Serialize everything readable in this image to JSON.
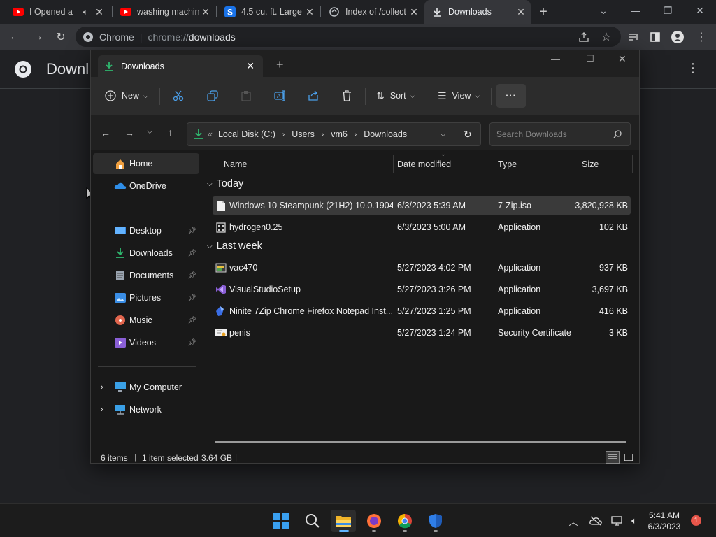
{
  "browser": {
    "tabs": [
      {
        "title": "I Opened a",
        "icon": "youtube-icon",
        "audio": true
      },
      {
        "title": "washing machin",
        "icon": "youtube-icon"
      },
      {
        "title": "4.5 cu. ft. Large",
        "icon": "s-site-icon"
      },
      {
        "title": "Index of /collect",
        "icon": "archive-icon"
      },
      {
        "title": "Downloads",
        "icon": "download-icon",
        "active": true
      }
    ],
    "new_tab": "+",
    "omnibox": {
      "prefix": "Chrome",
      "url_scheme": "chrome://",
      "url_host": "downloads"
    },
    "page_title": "Downl"
  },
  "explorer": {
    "tab_title": "Downloads",
    "new_tab": "+",
    "commands": {
      "new": "New",
      "sort": "Sort",
      "view": "View",
      "more": "···"
    },
    "breadcrumb": [
      "Local Disk (C:)",
      "Users",
      "vm6",
      "Downloads"
    ],
    "breadcrumb_overflow": "«",
    "search_placeholder": "Search Downloads",
    "nav": {
      "home": "Home",
      "onedrive": "OneDrive",
      "quick": [
        {
          "label": "Desktop",
          "icon": "desktop-icon",
          "color": "#3a8ee6"
        },
        {
          "label": "Downloads",
          "icon": "downloads-icon",
          "color": "#2fb86f"
        },
        {
          "label": "Documents",
          "icon": "documents-icon",
          "color": "#9aa4b0"
        },
        {
          "label": "Pictures",
          "icon": "pictures-icon",
          "color": "#3a8ee6"
        },
        {
          "label": "Music",
          "icon": "music-icon",
          "color": "#e2664e"
        },
        {
          "label": "Videos",
          "icon": "videos-icon",
          "color": "#8a5fd6"
        }
      ],
      "my_computer": "My Computer",
      "network": "Network"
    },
    "columns": {
      "name": "Name",
      "date": "Date modified",
      "type": "Type",
      "size": "Size"
    },
    "groups": [
      {
        "label": "Today",
        "files": [
          {
            "name": "Windows 10 Steampunk (21H2) 10.0.1904...",
            "date": "6/3/2023 5:39 AM",
            "type": "7-Zip.iso",
            "size": "3,820,928 KB",
            "icon": "file-icon",
            "selected": true
          },
          {
            "name": "hydrogen0.25",
            "date": "6/3/2023 5:00 AM",
            "type": "Application",
            "size": "102 KB",
            "icon": "app-icon"
          }
        ]
      },
      {
        "label": "Last week",
        "files": [
          {
            "name": "vac470",
            "date": "5/27/2023 4:02 PM",
            "type": "Application",
            "size": "937 KB",
            "icon": "installer-icon"
          },
          {
            "name": "VisualStudioSetup",
            "date": "5/27/2023 3:26 PM",
            "type": "Application",
            "size": "3,697 KB",
            "icon": "visual-studio-icon"
          },
          {
            "name": "Ninite 7Zip Chrome Firefox Notepad Inst...",
            "date": "5/27/2023 1:25 PM",
            "type": "Application",
            "size": "416 KB",
            "icon": "ninite-icon"
          },
          {
            "name": "penis",
            "date": "5/27/2023 1:24 PM",
            "type": "Security Certificate",
            "size": "3 KB",
            "icon": "certificate-icon"
          }
        ]
      }
    ],
    "status": {
      "items": "6 items",
      "selected": "1 item selected",
      "size": "3.64 GB"
    }
  },
  "taskbar": {
    "time": "5:41 AM",
    "date": "6/3/2023",
    "notification_count": "1"
  }
}
